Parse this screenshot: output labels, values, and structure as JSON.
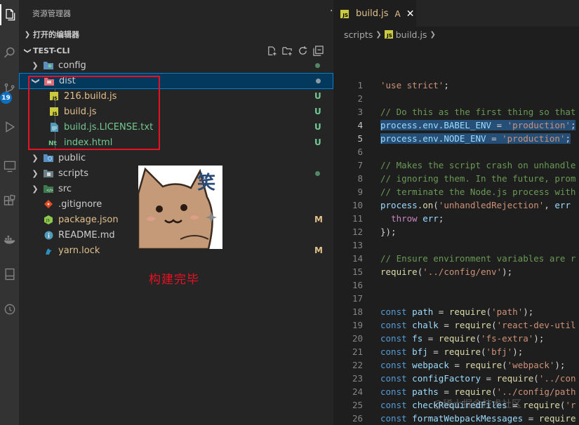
{
  "activity_bar": {
    "items": [
      "explorer-icon",
      "search-icon",
      "source-control-icon",
      "run-debug-icon",
      "remote-explorer-icon",
      "extensions-icon",
      "docker-icon",
      "bookmarks-icon",
      "timeline-icon"
    ],
    "scm_badge": "19"
  },
  "explorer": {
    "title": "资源管理器",
    "more": "···",
    "open_editors": "打开的编辑器",
    "project": "TEST-CLI",
    "tree": [
      {
        "label": "config",
        "type": "folder",
        "open": false,
        "color": "#73c991",
        "decor": "dot"
      },
      {
        "label": "dist",
        "type": "folder",
        "open": true,
        "color": "#cccccc",
        "decor": "dot",
        "selected": true
      },
      {
        "label": "216.build.js",
        "type": "js",
        "color": "#e2c08d",
        "status": "U"
      },
      {
        "label": "build.js",
        "type": "js",
        "color": "#e2c08d",
        "status": "U"
      },
      {
        "label": "build.js.LICENSE.txt",
        "type": "txt",
        "color": "#73c991",
        "status": "U"
      },
      {
        "label": "index.html",
        "type": "html",
        "color": "#73c991",
        "status": "U"
      },
      {
        "label": "public",
        "type": "folder",
        "open": false,
        "color": "#cccccc"
      },
      {
        "label": "scripts",
        "type": "folder",
        "open": false,
        "color": "#73c991",
        "decor": "dot"
      },
      {
        "label": "src",
        "type": "folder",
        "open": false,
        "color": "#cccccc"
      },
      {
        "label": ".gitignore",
        "type": "git",
        "color": "#cccccc"
      },
      {
        "label": "package.json",
        "type": "json",
        "color": "#e2c08d",
        "status": "M"
      },
      {
        "label": "README.md",
        "type": "md",
        "color": "#cccccc"
      },
      {
        "label": "yarn.lock",
        "type": "yarn",
        "color": "#e2c08d",
        "status": "M"
      }
    ],
    "sticker_text": "笑",
    "annotation": "构建完毕"
  },
  "editor": {
    "tab": {
      "label": "build.js",
      "status": "A",
      "close": "✕",
      "icon": "JS"
    },
    "breadcrumb": [
      "scripts",
      "build.js"
    ],
    "watermark": "@稀土掘金技术社区",
    "lines": [
      {
        "n": "1",
        "t": [
          [
            "s",
            "'use strict'"
          ],
          [
            "p",
            ";"
          ]
        ]
      },
      {
        "n": "2",
        "t": []
      },
      {
        "n": "3",
        "t": [
          [
            "c",
            "// Do this as the first thing so that"
          ]
        ]
      },
      {
        "n": "4",
        "t": [
          [
            "v",
            "process"
          ],
          [
            "p",
            "."
          ],
          [
            "v",
            "env"
          ],
          [
            "p",
            "."
          ],
          [
            "v",
            "BABEL_ENV"
          ],
          [
            "p",
            " = "
          ],
          [
            "s",
            "'production'"
          ],
          [
            "p",
            ";"
          ]
        ],
        "hl": true
      },
      {
        "n": "5",
        "t": [
          [
            "v",
            "process"
          ],
          [
            "p",
            "."
          ],
          [
            "v",
            "env"
          ],
          [
            "p",
            "."
          ],
          [
            "v",
            "NODE_ENV"
          ],
          [
            "p",
            " = "
          ],
          [
            "s",
            "'production'"
          ],
          [
            "p",
            ";"
          ]
        ],
        "hl": true
      },
      {
        "n": "6",
        "t": []
      },
      {
        "n": "7",
        "t": [
          [
            "c",
            "// Makes the script crash on unhandle"
          ]
        ]
      },
      {
        "n": "8",
        "t": [
          [
            "c",
            "// ignoring them. In the future, prom"
          ]
        ]
      },
      {
        "n": "9",
        "t": [
          [
            "c",
            "// terminate the Node.js process with"
          ]
        ]
      },
      {
        "n": "10",
        "t": [
          [
            "v",
            "process"
          ],
          [
            "p",
            "."
          ],
          [
            "f",
            "on"
          ],
          [
            "p",
            "("
          ],
          [
            "s",
            "'unhandledRejection'"
          ],
          [
            "p",
            ", "
          ],
          [
            "v",
            "err"
          ],
          [
            "p",
            " "
          ]
        ]
      },
      {
        "n": "11",
        "t": [
          [
            "p",
            "  "
          ],
          [
            "kc",
            "throw"
          ],
          [
            "p",
            " "
          ],
          [
            "v",
            "err"
          ],
          [
            "p",
            ";"
          ]
        ]
      },
      {
        "n": "12",
        "t": [
          [
            "p",
            "});"
          ]
        ]
      },
      {
        "n": "13",
        "t": []
      },
      {
        "n": "14",
        "t": [
          [
            "c",
            "// Ensure environment variables are r"
          ]
        ]
      },
      {
        "n": "15",
        "t": [
          [
            "f",
            "require"
          ],
          [
            "p",
            "("
          ],
          [
            "s",
            "'../config/env'"
          ],
          [
            "p",
            ");"
          ]
        ]
      },
      {
        "n": "16",
        "t": []
      },
      {
        "n": "17",
        "t": []
      },
      {
        "n": "18",
        "t": [
          [
            "k",
            "const"
          ],
          [
            "p",
            " "
          ],
          [
            "v",
            "path"
          ],
          [
            "p",
            " = "
          ],
          [
            "f",
            "require"
          ],
          [
            "p",
            "("
          ],
          [
            "s",
            "'path'"
          ],
          [
            "p",
            ");"
          ]
        ]
      },
      {
        "n": "19",
        "t": [
          [
            "k",
            "const"
          ],
          [
            "p",
            " "
          ],
          [
            "v",
            "chalk"
          ],
          [
            "p",
            " = "
          ],
          [
            "f",
            "require"
          ],
          [
            "p",
            "("
          ],
          [
            "s",
            "'react-dev-util"
          ]
        ]
      },
      {
        "n": "20",
        "t": [
          [
            "k",
            "const"
          ],
          [
            "p",
            " "
          ],
          [
            "v",
            "fs"
          ],
          [
            "p",
            " = "
          ],
          [
            "f",
            "require"
          ],
          [
            "p",
            "("
          ],
          [
            "s",
            "'fs-extra'"
          ],
          [
            "p",
            ");"
          ]
        ]
      },
      {
        "n": "21",
        "t": [
          [
            "k",
            "const"
          ],
          [
            "p",
            " "
          ],
          [
            "v",
            "bfj"
          ],
          [
            "p",
            " = "
          ],
          [
            "f",
            "require"
          ],
          [
            "p",
            "("
          ],
          [
            "s",
            "'bfj'"
          ],
          [
            "p",
            ");"
          ]
        ]
      },
      {
        "n": "22",
        "t": [
          [
            "k",
            "const"
          ],
          [
            "p",
            " "
          ],
          [
            "v",
            "webpack"
          ],
          [
            "p",
            " = "
          ],
          [
            "f",
            "require"
          ],
          [
            "p",
            "("
          ],
          [
            "s",
            "'webpack'"
          ],
          [
            "p",
            ");"
          ]
        ]
      },
      {
        "n": "23",
        "t": [
          [
            "k",
            "const"
          ],
          [
            "p",
            " "
          ],
          [
            "v",
            "configFactory"
          ],
          [
            "p",
            " = "
          ],
          [
            "f",
            "require"
          ],
          [
            "p",
            "("
          ],
          [
            "s",
            "'../con"
          ]
        ]
      },
      {
        "n": "24",
        "t": [
          [
            "k",
            "const"
          ],
          [
            "p",
            " "
          ],
          [
            "v",
            "paths"
          ],
          [
            "p",
            " = "
          ],
          [
            "f",
            "require"
          ],
          [
            "p",
            "("
          ],
          [
            "s",
            "'../config/path"
          ]
        ]
      },
      {
        "n": "25",
        "t": [
          [
            "k",
            "const"
          ],
          [
            "p",
            " "
          ],
          [
            "v",
            "checkRequiredFiles"
          ],
          [
            "p",
            " = "
          ],
          [
            "f",
            "require"
          ],
          [
            "p",
            "("
          ],
          [
            "s",
            "'r"
          ]
        ]
      },
      {
        "n": "26",
        "t": [
          [
            "k",
            "const"
          ],
          [
            "p",
            " "
          ],
          [
            "v",
            "formatWebpackMessages"
          ],
          [
            "p",
            " = "
          ],
          [
            "f",
            "require"
          ]
        ]
      }
    ]
  }
}
